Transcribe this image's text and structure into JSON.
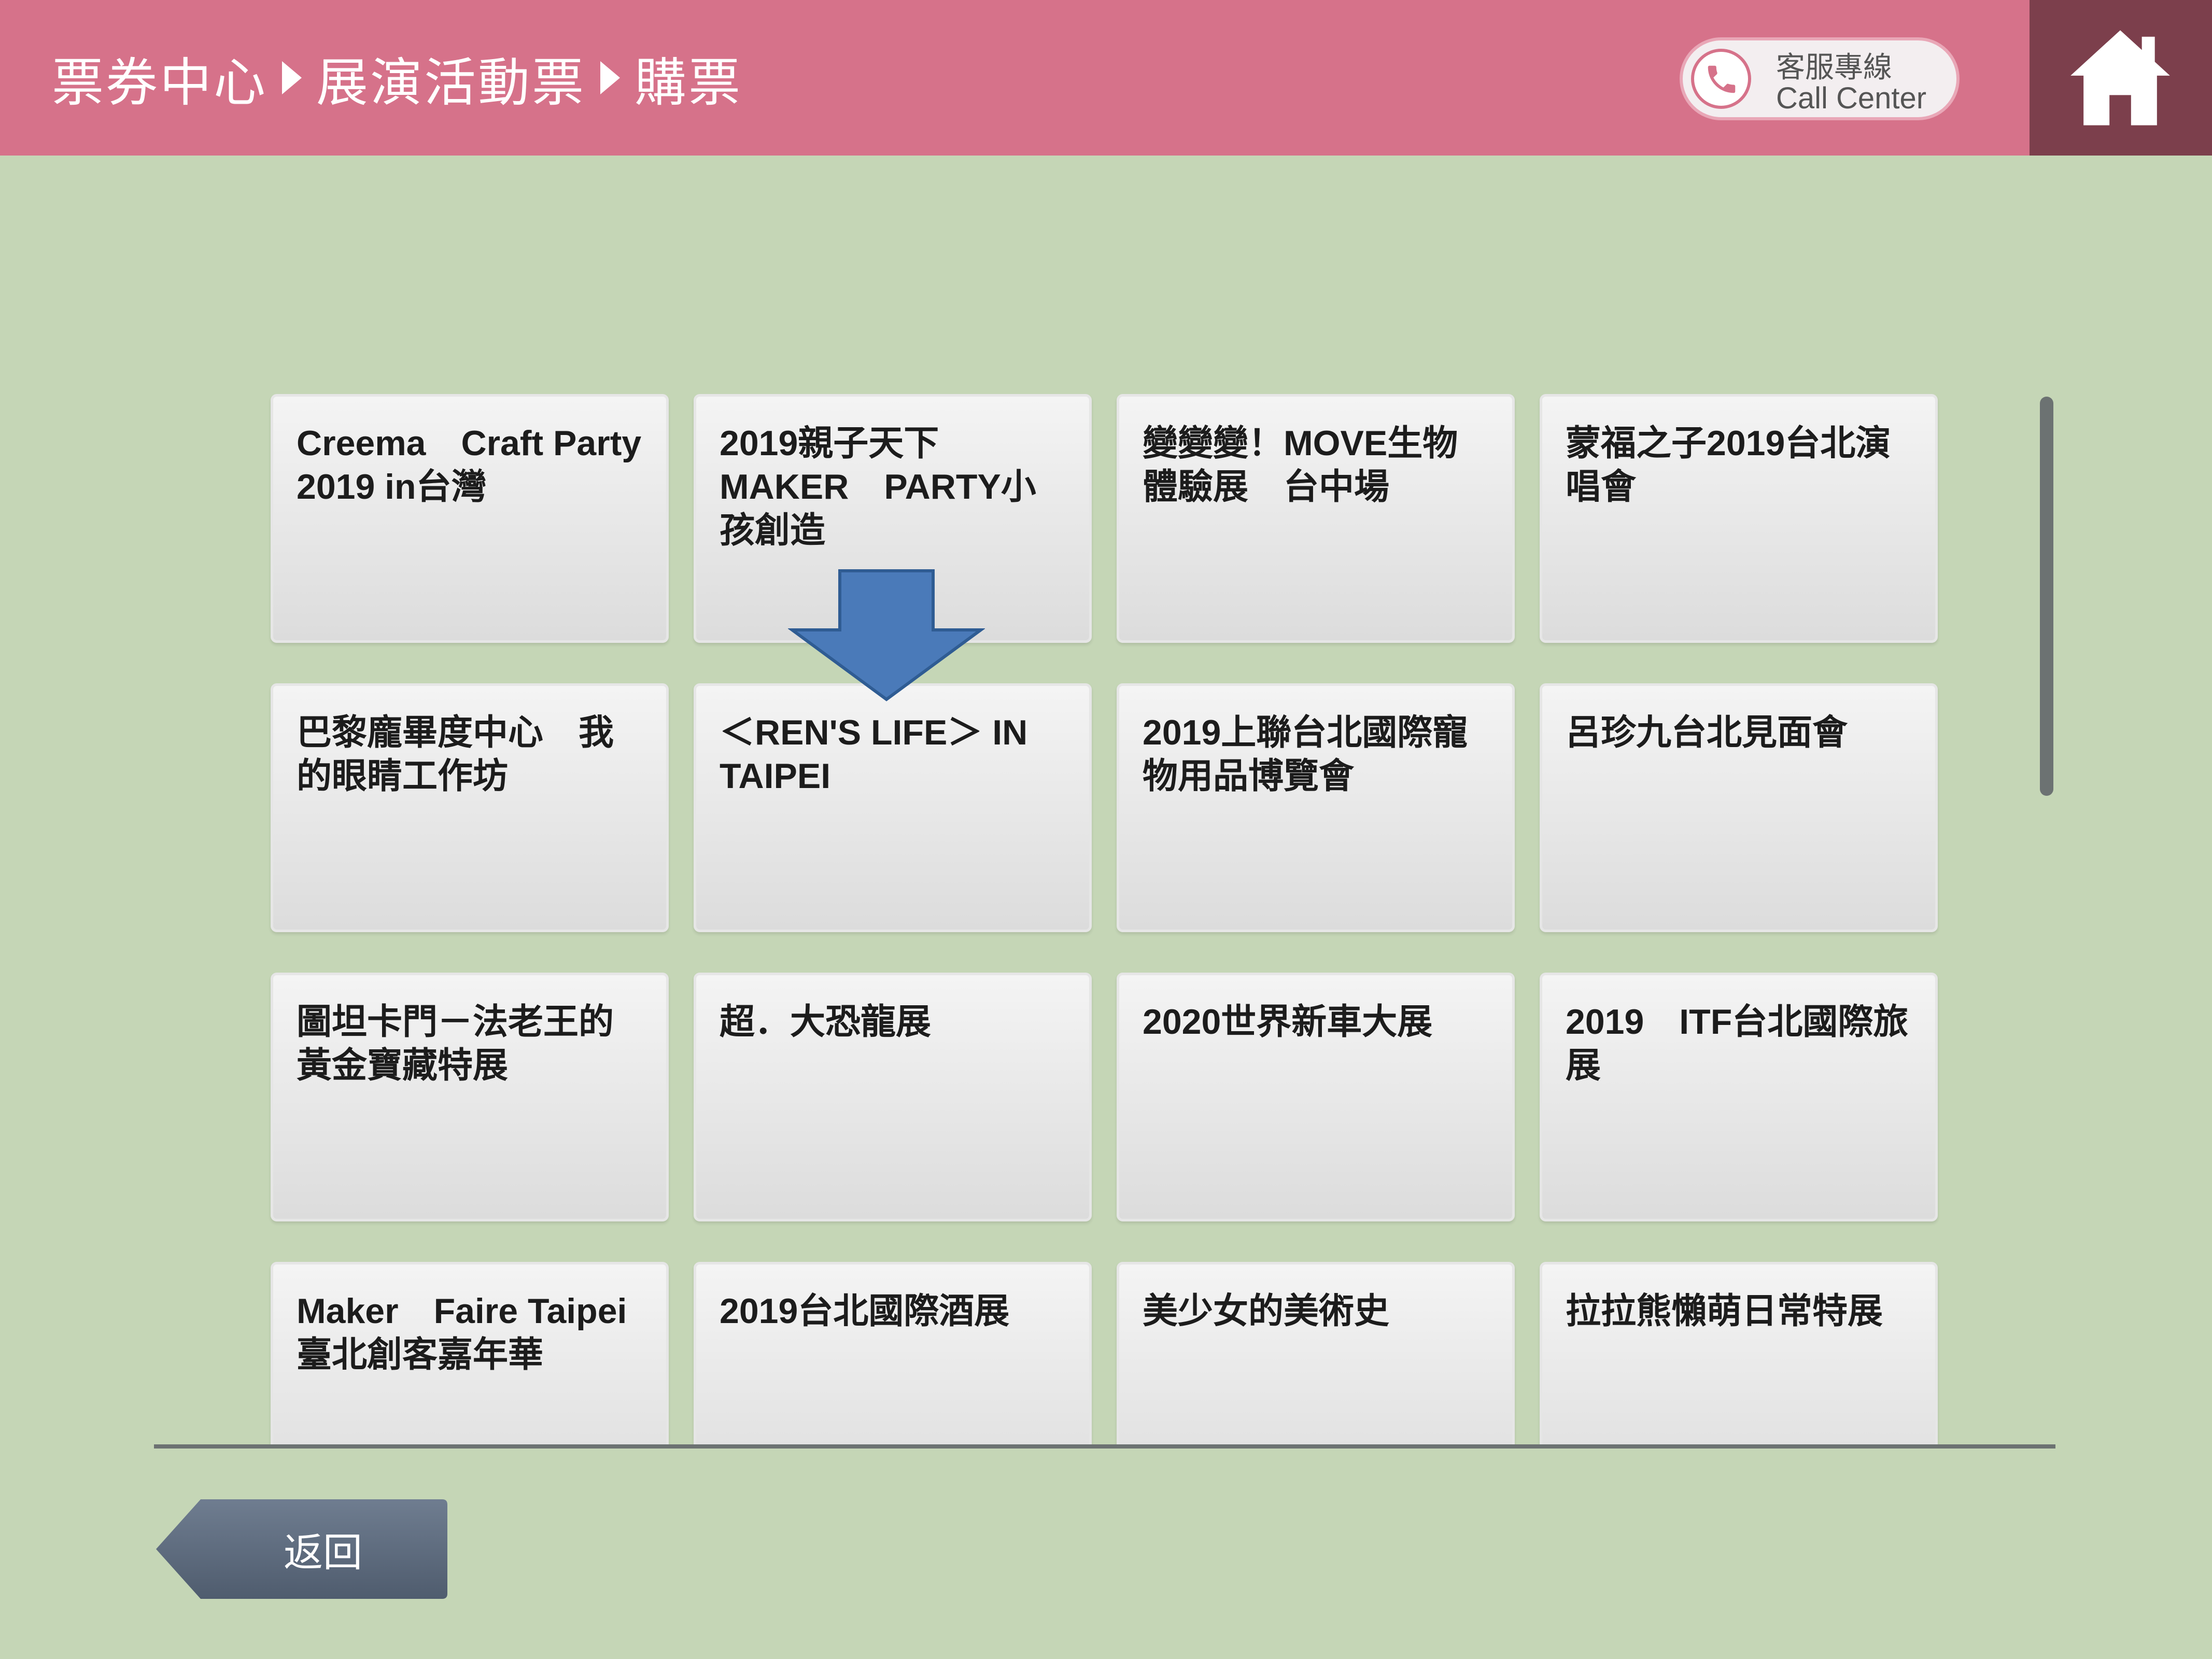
{
  "header": {
    "breadcrumb": [
      "票券中心",
      "展演活動票",
      "購票"
    ],
    "call_center_zh": "客服專線",
    "call_center_en": "Call Center"
  },
  "events": [
    "Creema　Craft Party　2019 in台灣",
    "2019親子天下 MAKER　PARTY小孩創造",
    "變變變！MOVE生物體驗展　台中場",
    "蒙福之子2019台北演唱會",
    "巴黎龐畢度中心　我的眼睛工作坊",
    "＜REN'S LIFE＞ IN TAIPEI",
    "2019上聯台北國際寵物用品博覽會",
    "呂珍九台北見面會",
    "圖坦卡門－法老王的黃金寶藏特展",
    "超．大恐龍展",
    "2020世界新車大展",
    "2019　ITF台北國際旅展",
    "Maker　Faire Taipei臺北創客嘉年華",
    "2019台北國際酒展",
    "美少女的美術史",
    "拉拉熊懶萌日常特展"
  ],
  "footer": {
    "back_label": "返回"
  },
  "colors": {
    "header": "#d6728a",
    "home": "#7c3f4c",
    "background": "#c5d6b6",
    "arrow": "#4a7ab9",
    "back_button": "#5f6d80"
  }
}
